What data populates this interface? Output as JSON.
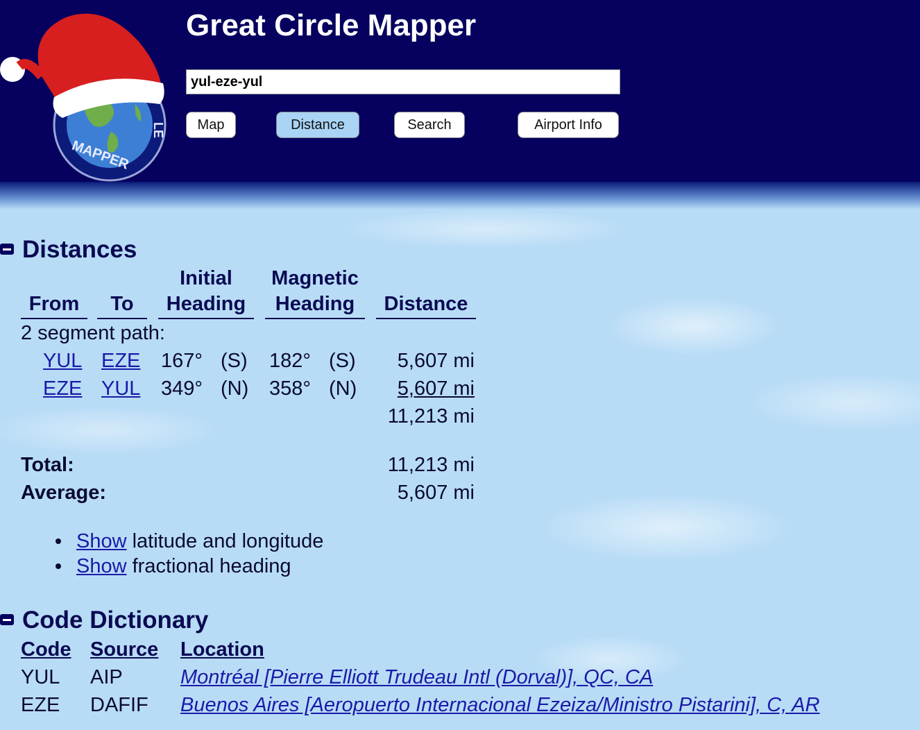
{
  "header": {
    "title": "Great Circle Mapper",
    "route_value": "yul-eze-yul",
    "buttons": {
      "map": "Map",
      "distance": "Distance",
      "search": "Search",
      "airport_info": "Airport Info"
    },
    "logo_text": "MAPPER",
    "logo_text_side": "LE"
  },
  "distances": {
    "heading": "Distances",
    "columns": {
      "from": "From",
      "to": "To",
      "initial_heading_1": "Initial",
      "initial_heading_2": "Heading",
      "magnetic_heading_1": "Magnetic",
      "magnetic_heading_2": "Heading",
      "distance": "Distance"
    },
    "segment_label": "2 segment path:",
    "rows": [
      {
        "from": "YUL",
        "to": "EZE",
        "init_deg": "167°",
        "init_dir": "(S)",
        "mag_deg": "182°",
        "mag_dir": "(S)",
        "distance": "5,607 mi"
      },
      {
        "from": "EZE",
        "to": "YUL",
        "init_deg": "349°",
        "init_dir": "(N)",
        "mag_deg": "358°",
        "mag_dir": "(N)",
        "distance": "5,607 mi"
      }
    ],
    "subtotal": "11,213 mi",
    "total_label": "Total:",
    "total_value": "11,213 mi",
    "average_label": "Average:",
    "average_value": "5,607 mi",
    "options": [
      {
        "link": "Show",
        "text": " latitude and longitude"
      },
      {
        "link": "Show",
        "text": " fractional heading"
      }
    ]
  },
  "code_dictionary": {
    "heading": "Code Dictionary",
    "columns": {
      "code": "Code",
      "source": "Source",
      "location": "Location"
    },
    "rows": [
      {
        "code": "YUL",
        "source": "AIP",
        "location": "Montréal [Pierre Elliott Trudeau Intl (Dorval)], QC, CA"
      },
      {
        "code": "EZE",
        "source": "DAFIF",
        "location": "Buenos Aires [Aeropuerto Internacional Ezeiza/Ministro Pistarini], C, AR"
      }
    ]
  },
  "colors": {
    "header_bg": "#06005e",
    "page_bg": "#b8dcf6",
    "heading_text": "#0a0a52",
    "link": "#1a1aa8",
    "active_button": "#a9d4f5"
  },
  "icons": [
    "santa-hat-globe-logo",
    "collapse-minus-icon"
  ]
}
